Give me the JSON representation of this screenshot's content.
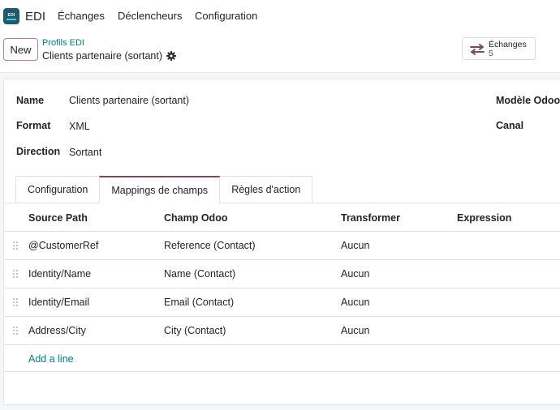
{
  "navbar": {
    "app_icon_text": "EDI",
    "brand": "EDI",
    "menu": [
      "Échanges",
      "Déclencheurs",
      "Configuration"
    ]
  },
  "control_panel": {
    "new_label": "New",
    "breadcrumb_parent": "Profils EDI",
    "breadcrumb_current": "Clients partenaire (sortant)",
    "smart_button": {
      "label": "Échanges",
      "count": "5"
    }
  },
  "form": {
    "fields": [
      {
        "label": "Name",
        "value": "Clients partenaire (sortant)"
      },
      {
        "label": "Format",
        "value": "XML"
      },
      {
        "label": "Direction",
        "value": "Sortant"
      }
    ],
    "right_labels": [
      "Modèle Odoo",
      "Canal"
    ]
  },
  "tabs": [
    {
      "label": "Configuration",
      "active": false
    },
    {
      "label": "Mappings de champs",
      "active": true
    },
    {
      "label": "Règles d'action",
      "active": false
    }
  ],
  "table": {
    "columns": [
      "Source Path",
      "Champ Odoo",
      "Transformer",
      "Expression"
    ],
    "rows": [
      {
        "source": "@CustomerRef",
        "field": "Reference (Contact)",
        "transformer": "Aucun",
        "expression": ""
      },
      {
        "source": "Identity/Name",
        "field": "Name (Contact)",
        "transformer": "Aucun",
        "expression": ""
      },
      {
        "source": "Identity/Email",
        "field": "Email (Contact)",
        "transformer": "Aucun",
        "expression": ""
      },
      {
        "source": "Address/City",
        "field": "City (Contact)",
        "transformer": "Aucun",
        "expression": ""
      }
    ],
    "add_line_label": "Add a line"
  },
  "colors": {
    "primary": "#714b67",
    "link": "#017e84",
    "app_icon_bg": "#1d5a6c"
  }
}
